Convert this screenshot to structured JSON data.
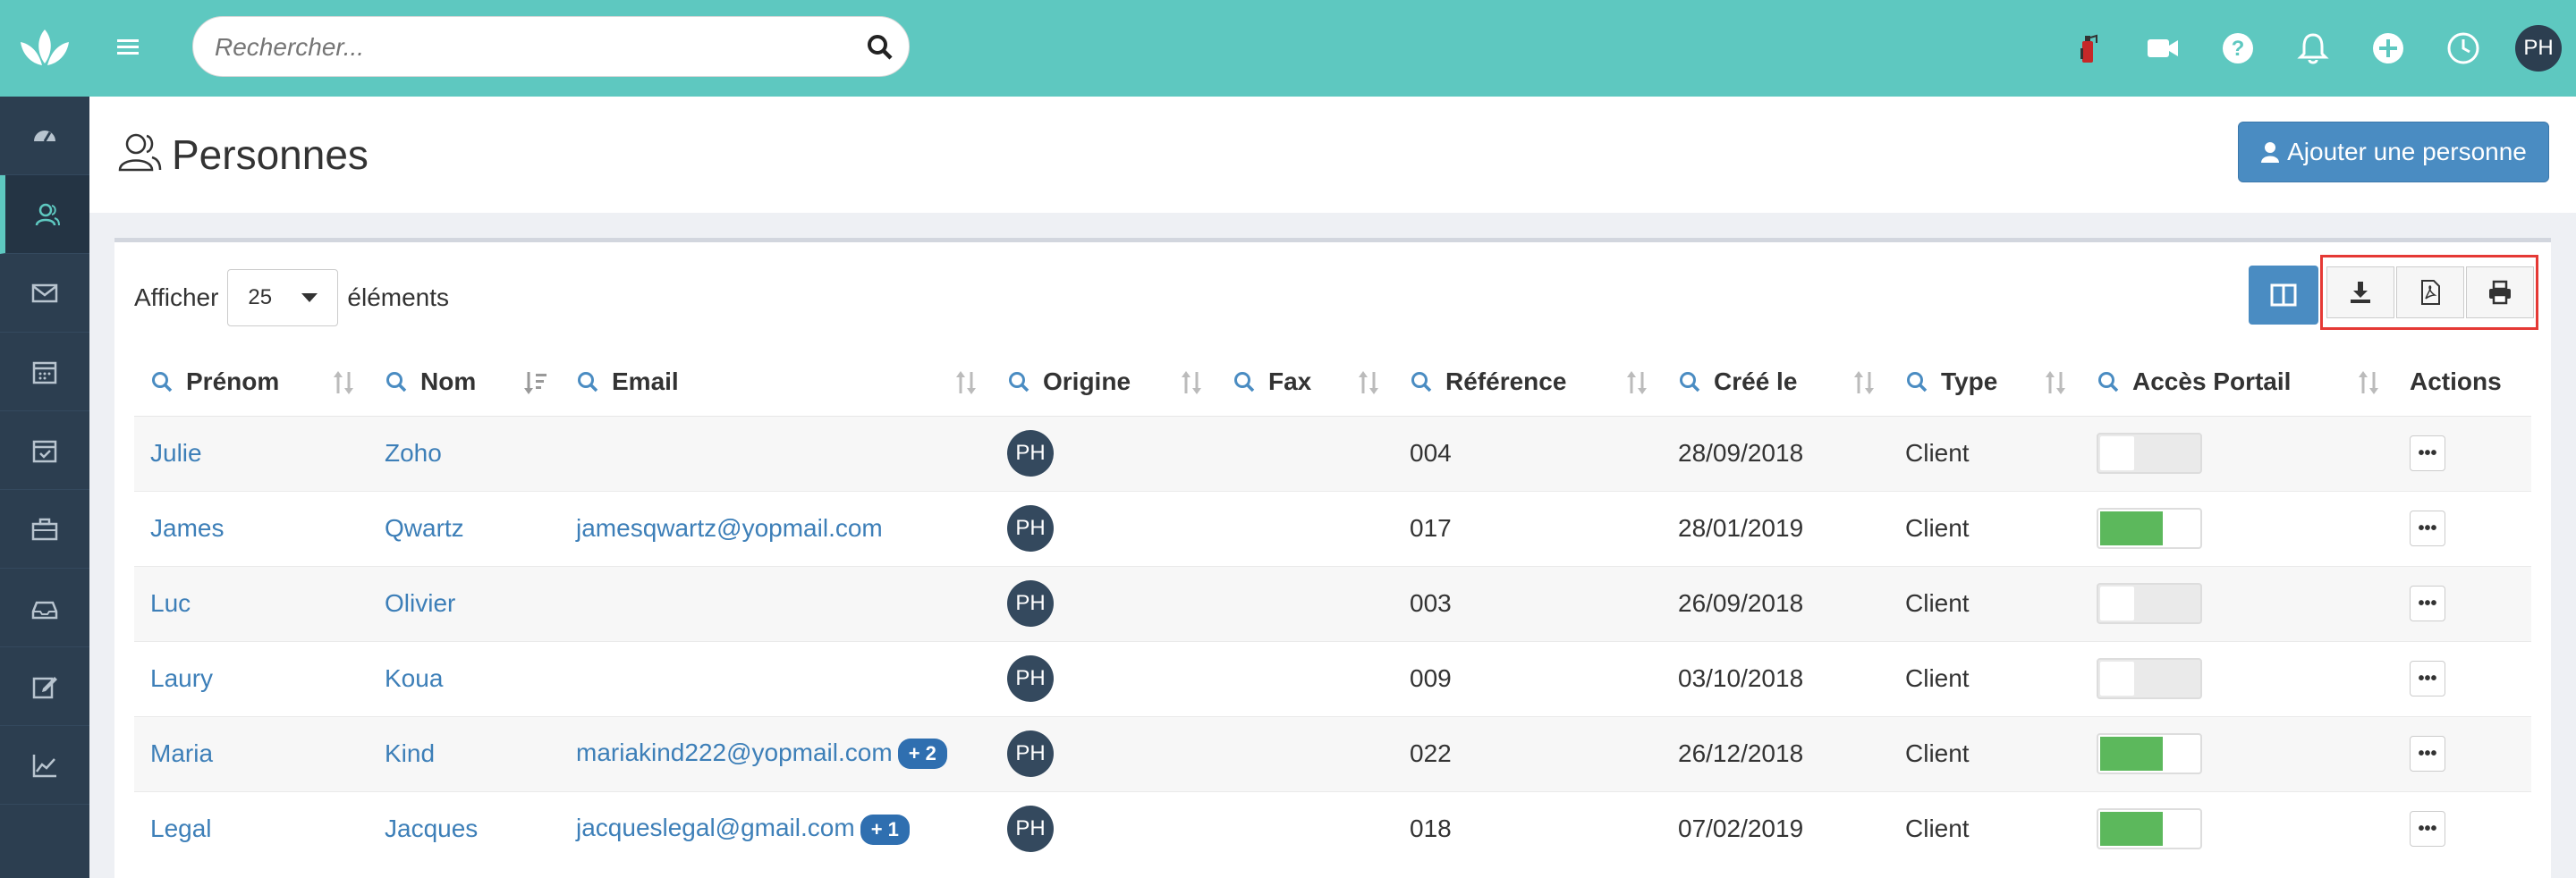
{
  "search": {
    "placeholder": "Rechercher..."
  },
  "header": {
    "title": "Personnes",
    "add_button": "Ajouter une personne"
  },
  "topbar": {
    "avatar": "PH"
  },
  "sidebar": {
    "items": [
      "dashboard-icon",
      "persons-icon",
      "mail-icon",
      "calendar-icon",
      "tasks-icon",
      "briefcase-icon",
      "inbox-icon",
      "edit-icon",
      "chart-icon"
    ]
  },
  "table_controls": {
    "show_label": "Afficher",
    "page_size": "25",
    "elements_label": "éléments"
  },
  "columns": [
    "Prénom",
    "Nom",
    "Email",
    "Origine",
    "Fax",
    "Référence",
    "Créé le",
    "Type",
    "Accès Portail",
    "Actions"
  ],
  "rows": [
    {
      "prenom": "Julie",
      "nom": "Zoho",
      "email": "",
      "extra": "",
      "origine": "PH",
      "fax": "",
      "reference": "004",
      "cree_le": "28/09/2018",
      "type": "Client",
      "portail": "off"
    },
    {
      "prenom": "James",
      "nom": "Qwartz",
      "email": "jamesqwartz@yopmail.com",
      "extra": "",
      "origine": "PH",
      "fax": "",
      "reference": "017",
      "cree_le": "28/01/2019",
      "type": "Client",
      "portail": "on"
    },
    {
      "prenom": "Luc",
      "nom": "Olivier",
      "email": "",
      "extra": "",
      "origine": "PH",
      "fax": "",
      "reference": "003",
      "cree_le": "26/09/2018",
      "type": "Client",
      "portail": "off"
    },
    {
      "prenom": "Laury",
      "nom": "Koua",
      "email": "",
      "extra": "",
      "origine": "PH",
      "fax": "",
      "reference": "009",
      "cree_le": "03/10/2018",
      "type": "Client",
      "portail": "off"
    },
    {
      "prenom": "Maria",
      "nom": "Kind",
      "email": "mariakind222@yopmail.com",
      "extra": "+ 2",
      "origine": "PH",
      "fax": "",
      "reference": "022",
      "cree_le": "26/12/2018",
      "type": "Client",
      "portail": "on"
    },
    {
      "prenom": "Legal",
      "nom": "Jacques",
      "email": "jacqueslegal@gmail.com",
      "extra": "+ 1",
      "origine": "PH",
      "fax": "",
      "reference": "018",
      "cree_le": "07/02/2019",
      "type": "Client",
      "portail": "on"
    }
  ],
  "actions_glyph": "•••",
  "colors": {
    "accent": "#5ec8c0",
    "sidebar": "#2c3e50",
    "primary": "#4a8cc2",
    "toggle_on": "#5cb85c",
    "highlight_border": "#e53935"
  }
}
